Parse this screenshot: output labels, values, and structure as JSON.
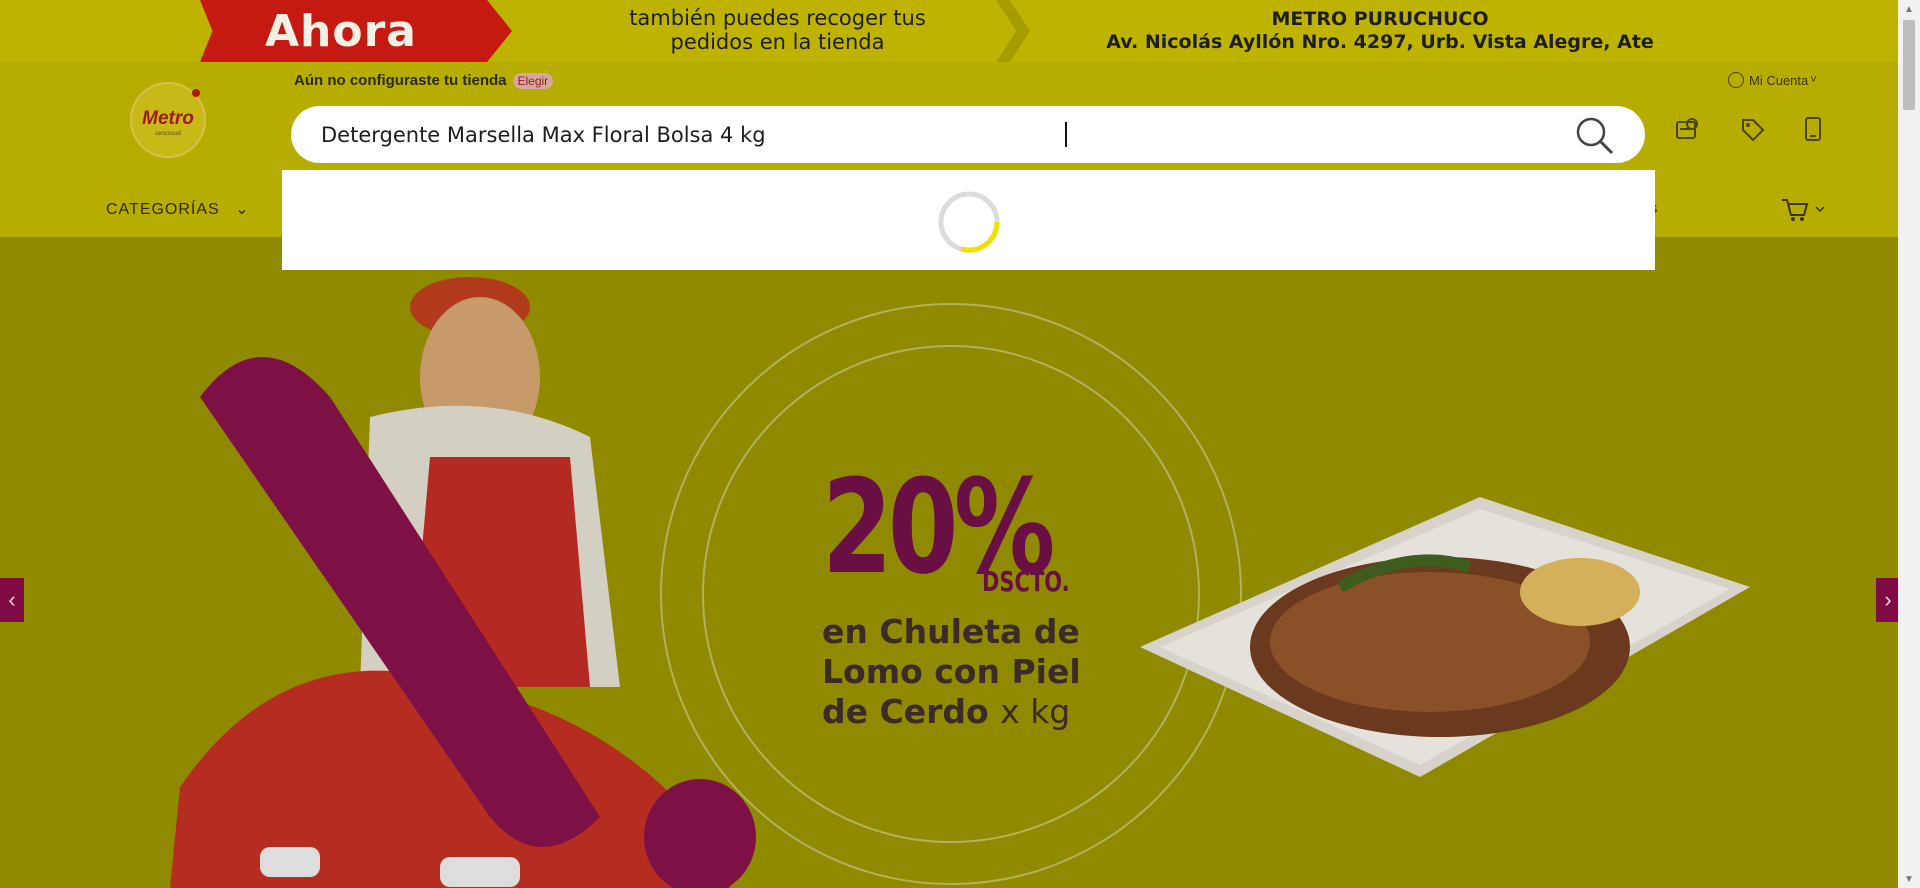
{
  "promo": {
    "ahora": "Ahora",
    "line1": "también puedes recoger tus",
    "line2": "pedidos en la tienda",
    "store_name": "METRO PURUCHUCO",
    "store_address": "Av. Nicolás Ayllón Nro. 4297, Urb. Vista Alegre, Ate"
  },
  "header": {
    "logo_word": "Metro",
    "logo_sub": "cencosud",
    "store_note": "Aún no configuraste tu tienda",
    "elegir": "Elegir",
    "account": "Mi Cuenta",
    "account_chevron": "˅"
  },
  "search": {
    "value": "Detergente Marsella Max Floral Bolsa 4 kg",
    "icon": "search-icon"
  },
  "nav": {
    "categories": "CATEGORÍAS",
    "categories_chevron": "⌄",
    "right_text": "ctos"
  },
  "hero": {
    "percent": "20%",
    "dscto": "DSCTO.",
    "desc_line1": "en Chuleta de",
    "desc_line2": "Lomo con Piel",
    "desc_line3": "de Cerdo",
    "xkg": "x kg",
    "arrow_left": "‹",
    "arrow_right": "›"
  },
  "colors": {
    "banner": "#bdb300",
    "header": "#b7ac00",
    "hero_bg": "#8f8a00",
    "accent_magenta": "#7f0a44",
    "promo_red": "#c41a12"
  }
}
